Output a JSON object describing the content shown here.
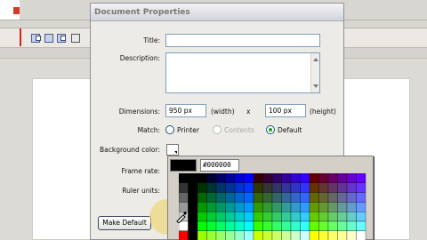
{
  "dialog": {
    "title": "Document Properties",
    "title_label": "Title:",
    "title_value": "",
    "description_label": "Description:",
    "description_value": "",
    "dimensions_label": "Dimensions:",
    "width_value": "950 px",
    "width_caption": "(width)",
    "times_sign": "x",
    "height_value": "100 px",
    "height_caption": "(height)",
    "match_label": "Match:",
    "match_options": [
      "Printer",
      "Contents",
      "Default"
    ],
    "match_selected": "Default",
    "background_label": "Background color:",
    "frame_rate_label": "Frame rate:",
    "ruler_units_label": "Ruler units:",
    "make_default_label": "Make Default"
  },
  "picker": {
    "current_color": "#000000",
    "hex_value": "#000000"
  },
  "colors": {
    "accent_selected_radio": "#2a9a2a",
    "playhead": "#d5221c"
  }
}
